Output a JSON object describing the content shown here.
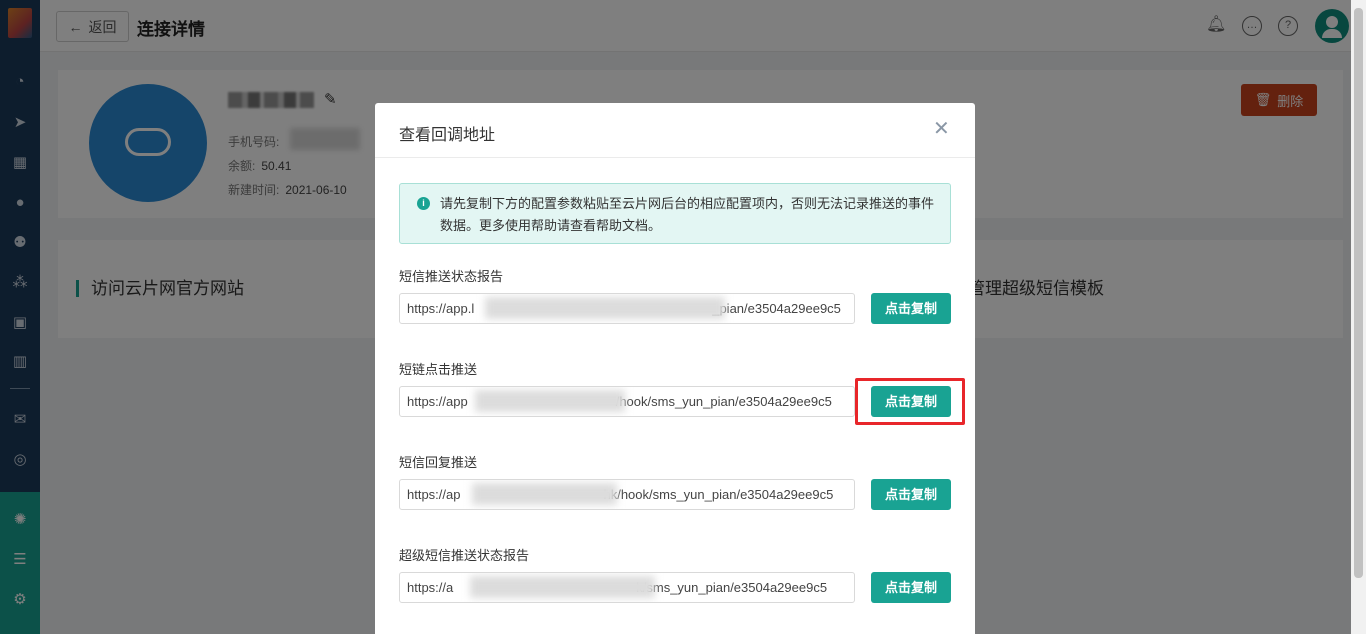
{
  "header": {
    "back_label": "返回",
    "back_icon": "arrow-left-icon",
    "title": "连接详情",
    "icons": [
      "bell-icon",
      "chat-icon",
      "help-icon",
      "user-avatar-icon"
    ]
  },
  "sidebar": {
    "icons": [
      "dashboard-icon",
      "send-icon",
      "layout-icon",
      "user-icon",
      "users-icon",
      "cluster-icon",
      "bookmark-icon",
      "bar-chart-icon",
      "wechat-icon",
      "target-icon",
      "team-icon",
      "server-icon",
      "settings-icon"
    ]
  },
  "profile": {
    "phone_label": "手机号码:",
    "balance_label": "余额:",
    "balance_value": "50.41",
    "created_label": "新建时间:",
    "created_value": "2021-06-10",
    "delete_label": "删除"
  },
  "links": {
    "visit": "访问云片网官方网站",
    "manage": "管理超级短信模板"
  },
  "modal": {
    "title": "查看回调地址",
    "notice": "请先复制下方的配置参数粘贴至云片网后台的相应配置项内，否则无法记录推送的事件数据。更多使用帮助请查看帮助文档。",
    "copy_label": "点击复制",
    "fields": [
      {
        "label": "短信推送状态报告",
        "prefix": "https://app.l",
        "suffix": "_pian/e3504a29ee9c5"
      },
      {
        "label": "短链点击推送",
        "prefix": "https://app",
        "suffix": "/hook/sms_yun_pian/e3504a29ee9c5"
      },
      {
        "label": "短信回复推送",
        "prefix": "https://ap",
        "suffix": "hk/hook/sms_yun_pian/e3504a29ee9c5"
      },
      {
        "label": "超级短信推送状态报告",
        "prefix": "https://a",
        "suffix": "k/sms_yun_pian/e3504a29ee9c5"
      }
    ]
  },
  "colors": {
    "accent": "#19a393",
    "danger": "#c9431d",
    "sidebar": "#1b3a5a",
    "highlight": "#e8262a"
  }
}
